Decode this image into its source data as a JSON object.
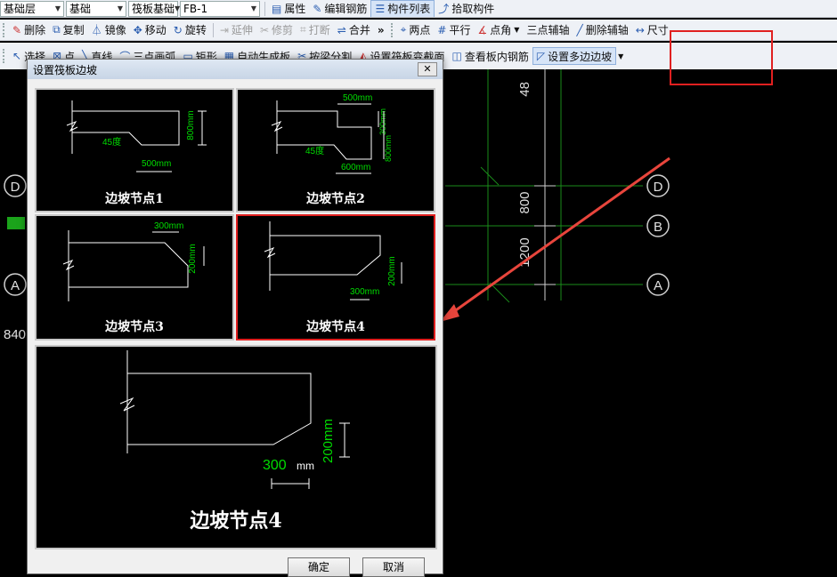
{
  "toolbar1": {
    "floor": "基础层",
    "category": "基础",
    "type": "筏板基础",
    "element": "FB-1",
    "properties": "属性",
    "edit_rebar": "编辑钢筋",
    "component_list": "构件列表",
    "pick": "拾取构件"
  },
  "toolbar2": {
    "delete": "删除",
    "copy": "复制",
    "mirror": "镜像",
    "move": "移动",
    "rotate": "旋转",
    "extend": "延伸",
    "trim": "修剪",
    "break": "打断",
    "merge": "合并",
    "more": "»",
    "two_point": "两点",
    "parallel": "平行",
    "point_angle": "点角",
    "three_point_axis": "三点辅轴",
    "delete_axis": "删除辅轴",
    "dimension": "尺寸"
  },
  "toolbar3": {
    "select": "选择",
    "point": "点",
    "line": "直线",
    "arc": "三点画弧",
    "rect": "矩形",
    "auto_gen": "自动生成板",
    "split_by_beam": "按梁分割",
    "set_section": "设置筏板变截面",
    "view_rebar": "查看板内钢筋",
    "set_multi_slope": "设置多边边坡"
  },
  "canvas": {
    "axes": [
      "D",
      "B",
      "A"
    ],
    "left_axes": [
      "D",
      "A"
    ],
    "dims": [
      "48",
      "800",
      "1200"
    ],
    "left_dim": "840"
  },
  "dialog": {
    "title": "设置筏板边坡",
    "close": "✕",
    "cells": [
      {
        "caption": "边坡节点1",
        "labels": [
          "45度",
          "500mm",
          "800mm"
        ]
      },
      {
        "caption": "边坡节点2",
        "labels": [
          "500mm",
          "300mm",
          "45度",
          "600mm",
          "800mm"
        ]
      },
      {
        "caption": "边坡节点3",
        "labels": [
          "300mm",
          "200mm"
        ]
      },
      {
        "caption": "边坡节点4",
        "labels": [
          "200mm",
          "300mm"
        ]
      }
    ],
    "preview": {
      "caption": "边坡节点4",
      "dim_h_value": "300",
      "dim_h_unit": "mm",
      "dim_v": "200mm"
    },
    "ok": "确定",
    "cancel": "取消"
  },
  "colors": {
    "dim_green": "#00dd00",
    "highlight": "#e02020",
    "grid": "#1a8c1a"
  }
}
